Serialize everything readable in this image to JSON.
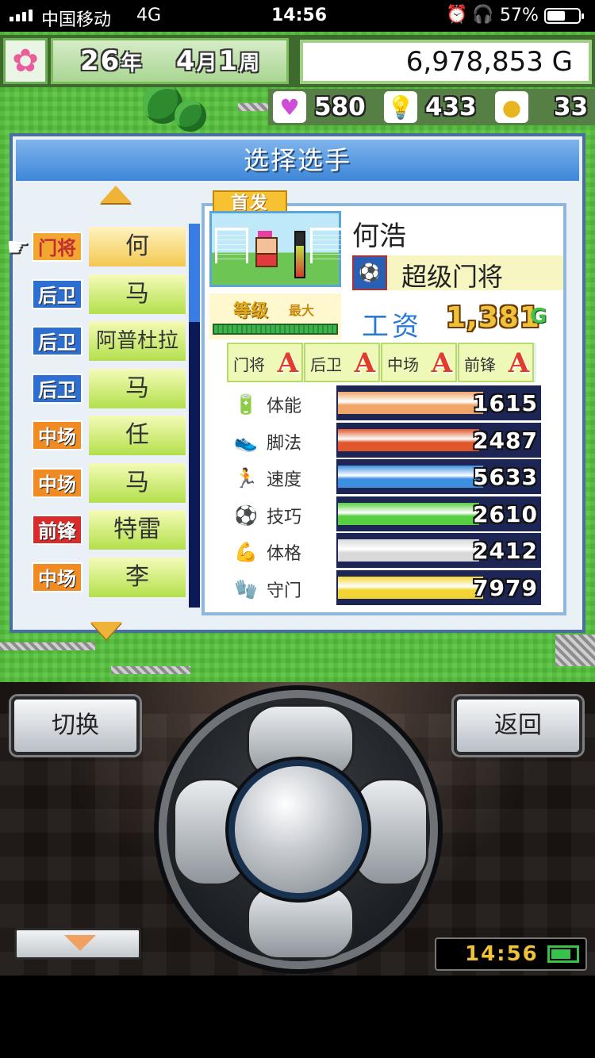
{
  "status_bar": {
    "carrier": "中国移动",
    "network": "4G",
    "time": "14:56",
    "battery_percent": "57%",
    "battery_level": 0.57
  },
  "hud": {
    "year": "26",
    "year_unit": "年",
    "month": "4",
    "month_unit": "月",
    "week": "1",
    "week_unit": "周",
    "money": "6,978,853 G",
    "hearts": "580",
    "ideas": "433",
    "coins": "33",
    "icons": [
      "flower-icon",
      "heart-icon",
      "lightbulb-icon",
      "coin-icon"
    ]
  },
  "dialog": {
    "title": "选择选手"
  },
  "players": [
    {
      "position": "门将",
      "position_type": "gk",
      "name": "何",
      "selected": true
    },
    {
      "position": "后卫",
      "position_type": "df",
      "name": "马",
      "selected": false
    },
    {
      "position": "后卫",
      "position_type": "df",
      "name": "阿普杜拉",
      "selected": false
    },
    {
      "position": "后卫",
      "position_type": "df",
      "name": "马",
      "selected": false
    },
    {
      "position": "中场",
      "position_type": "mf",
      "name": "任",
      "selected": false
    },
    {
      "position": "中场",
      "position_type": "mf",
      "name": "马",
      "selected": false
    },
    {
      "position": "前锋",
      "position_type": "fw",
      "name": "特雷",
      "selected": false
    },
    {
      "position": "中场",
      "position_type": "mf",
      "name": "李",
      "selected": false
    }
  ],
  "detail": {
    "starter_tag": "首发",
    "player_name": "何浩",
    "skill": "超级门将",
    "level_label": "等级",
    "level_max": "最大",
    "salary_label": "工资",
    "salary_value": "1,381",
    "salary_unit": "G",
    "aptitudes": [
      {
        "label": "门将",
        "grade": "A"
      },
      {
        "label": "后卫",
        "grade": "A"
      },
      {
        "label": "中场",
        "grade": "A"
      },
      {
        "label": "前锋",
        "grade": "A"
      }
    ],
    "stats": [
      {
        "label": "体能",
        "value": "1615",
        "fill": 0.72,
        "color": "#f0a668",
        "icon": "stamina-icon"
      },
      {
        "label": "脚法",
        "value": "2487",
        "fill": 0.7,
        "color": "#e2562b",
        "icon": "kick-icon"
      },
      {
        "label": "速度",
        "value": "5633",
        "fill": 0.72,
        "color": "#3f8fe0",
        "icon": "speed-icon"
      },
      {
        "label": "技巧",
        "value": "2610",
        "fill": 0.7,
        "color": "#57cf42",
        "icon": "dribble-icon"
      },
      {
        "label": "体格",
        "value": "2412",
        "fill": 0.7,
        "color": "#d9d9d9",
        "icon": "muscle-icon"
      },
      {
        "label": "守门",
        "value": "7979",
        "fill": 0.72,
        "color": "#f2d535",
        "icon": "goalkeep-icon"
      }
    ]
  },
  "controller": {
    "switch_label": "切换",
    "back_label": "返回",
    "clock": "14:56"
  }
}
